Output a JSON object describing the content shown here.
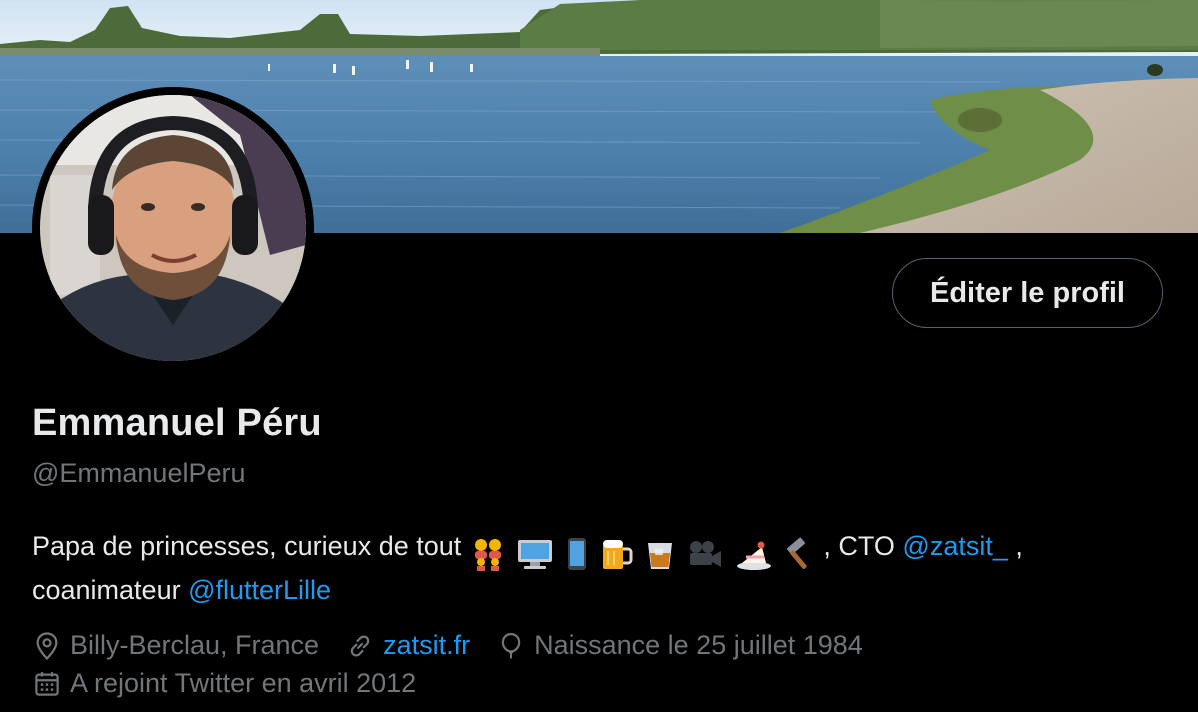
{
  "profile": {
    "display_name": "Emmanuel Péru",
    "handle": "@EmmanuelPeru",
    "edit_button_label": "Éditer le profil",
    "bio": {
      "text_before": "Papa de princesses, curieux de tout",
      "emojis": [
        "family-icon",
        "desktop-computer-icon",
        "mobile-phone-icon",
        "beer-mug-icon",
        "whisky-glass-icon",
        "movie-camera-icon",
        "cake-icon",
        "hammer-icon"
      ],
      "text_cto": ", CTO ",
      "mention_company": "@zatsit_",
      "text_after_company": " ,",
      "text_line2": "coanimateur ",
      "mention_meetup": "@flutterLille"
    },
    "meta": {
      "location": "Billy-Berclau, France",
      "website": "zatsit.fr",
      "birthday": "Naissance le 25 juillet 1984",
      "joined": "A rejoint Twitter en avril 2012"
    }
  },
  "colors": {
    "background": "#000000",
    "text_primary": "#e7e9ea",
    "text_secondary": "#71767b",
    "link": "#1d9bf0",
    "button_border": "#536471"
  }
}
